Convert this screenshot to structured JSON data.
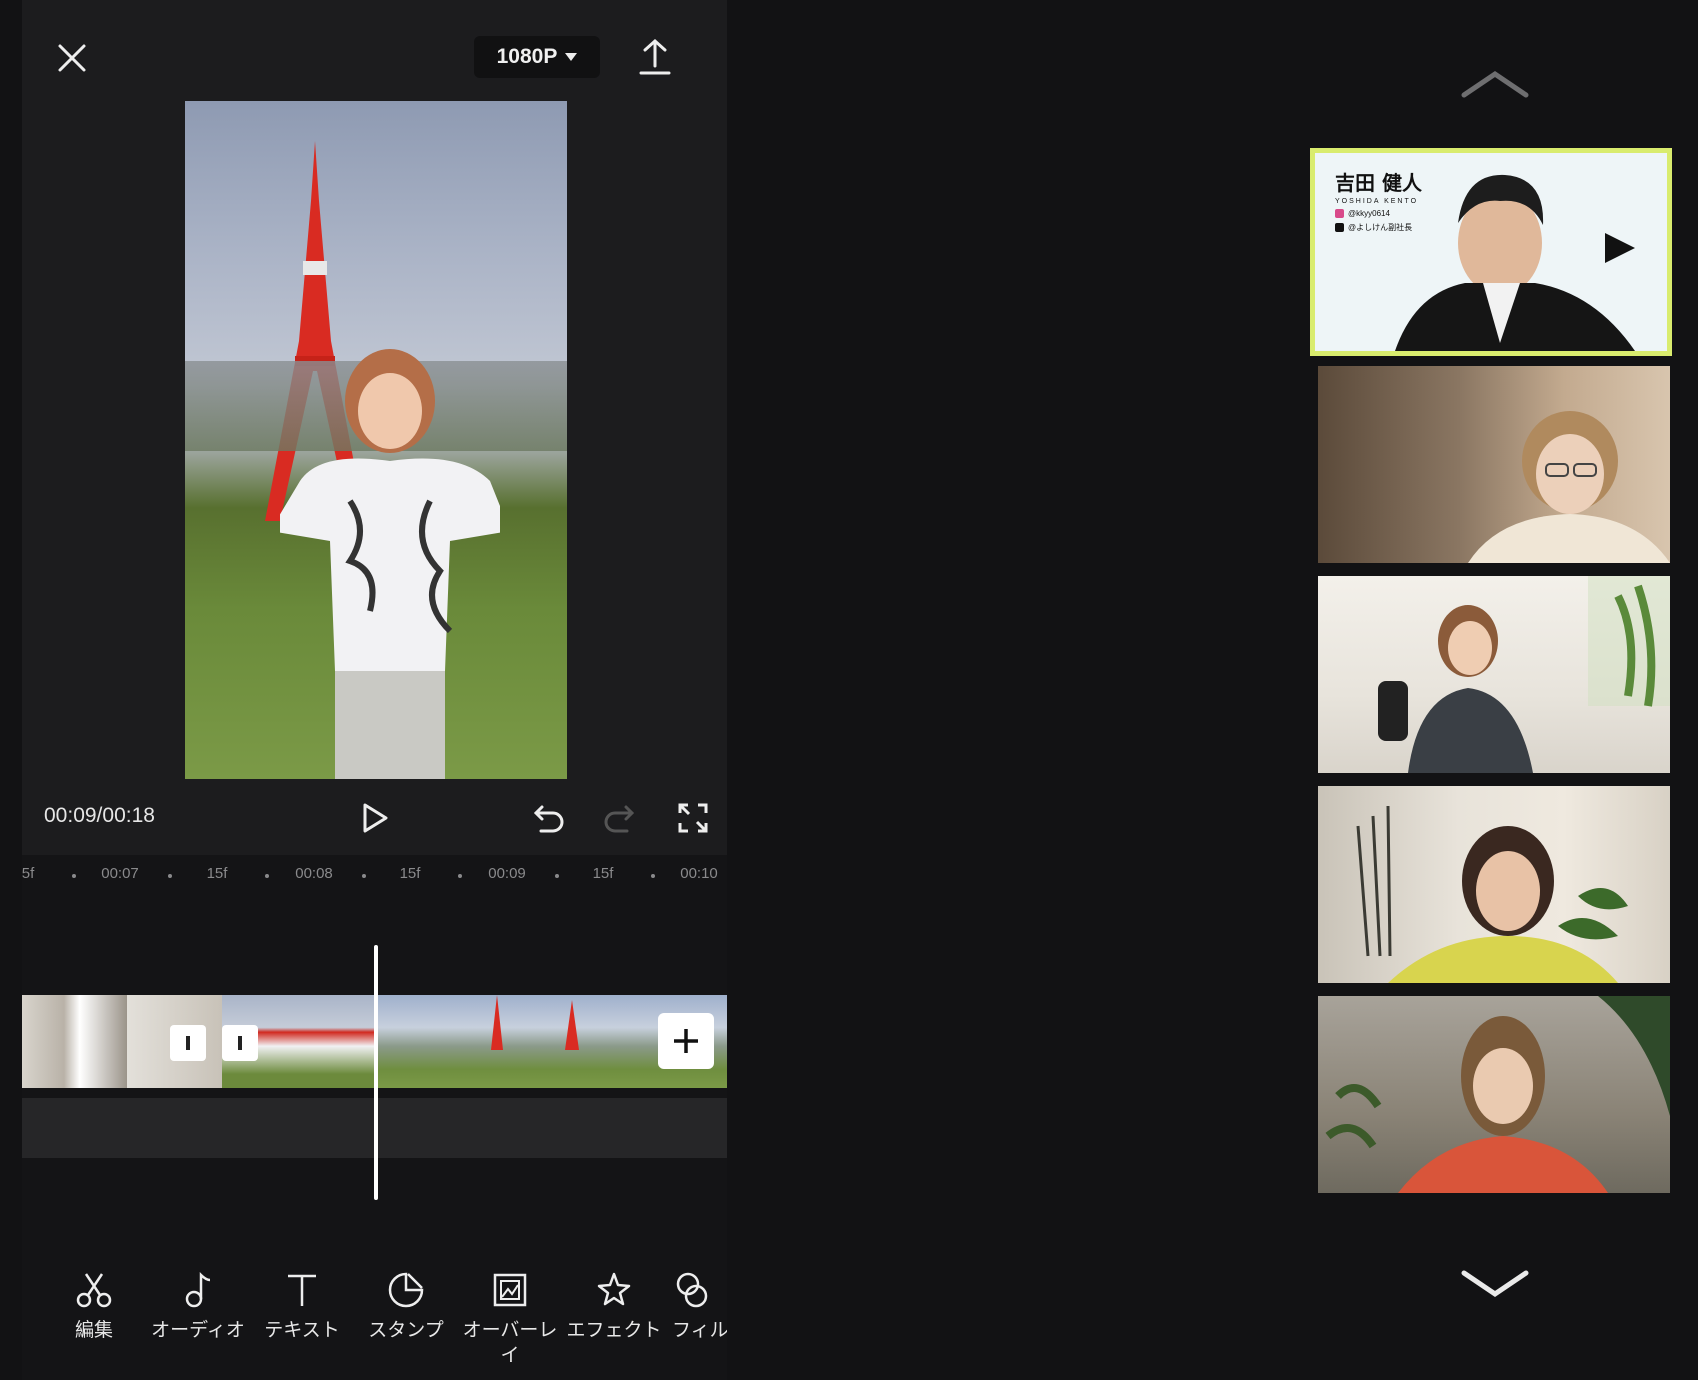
{
  "editor": {
    "resolution": "1080P",
    "time_readout": "00:09/00:18",
    "ruler": [
      "5f",
      "00:07",
      "15f",
      "00:08",
      "15f",
      "00:09",
      "15f",
      "00:10"
    ],
    "toolbar": [
      {
        "label": "編集",
        "icon": "scissors-icon"
      },
      {
        "label": "オーディオ",
        "icon": "music-note-icon"
      },
      {
        "label": "テキスト",
        "icon": "text-icon"
      },
      {
        "label": "スタンプ",
        "icon": "sticker-icon"
      },
      {
        "label": "オーバーレイ",
        "icon": "overlay-icon"
      },
      {
        "label": "エフェクト",
        "icon": "effect-star-icon"
      },
      {
        "label": "フィル",
        "icon": "filter-icon"
      }
    ]
  },
  "participants": {
    "speaker_name": "吉田 健人",
    "speaker_roman": "YOSHIDA KENTO",
    "speaker_instagram": "@kkyy0614",
    "speaker_tiktok": "@よしけん副社長",
    "active_border_color": "#d9ec6e"
  }
}
